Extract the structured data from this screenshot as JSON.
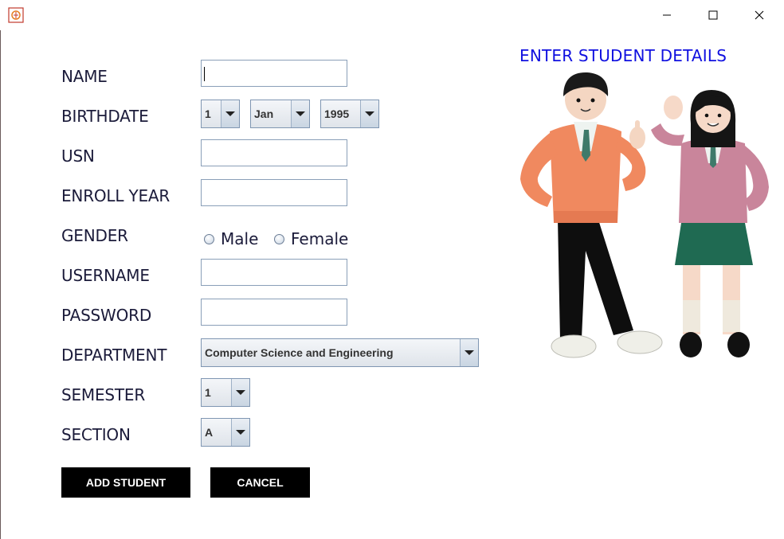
{
  "window": {
    "controls": {
      "minimize": "minimize",
      "maximize": "maximize",
      "close": "close"
    }
  },
  "heading": "ENTER STUDENT DETAILS",
  "form": {
    "name_label": "NAME",
    "name_value": "",
    "birthdate_label": "BIRTHDATE",
    "birth_day": "1",
    "birth_month": "Jan",
    "birth_year": "1995",
    "usn_label": "USN",
    "usn_value": "",
    "enroll_year_label": "ENROLL YEAR",
    "enroll_year_value": "",
    "gender_label": "GENDER",
    "gender_options": [
      "Male",
      "Female"
    ],
    "username_label": "USERNAME",
    "username_value": "",
    "password_label": "PASSWORD",
    "password_value": "",
    "department_label": "DEPARTMENT",
    "department_value": "Computer Science and Engineering",
    "semester_label": "SEMESTER",
    "semester_value": "1",
    "section_label": "SECTION",
    "section_value": "A"
  },
  "buttons": {
    "add_student": "ADD STUDENT",
    "cancel": "CANCEL"
  },
  "colors": {
    "heading": "#1010e0",
    "button_bg": "#000000",
    "button_text": "#ffffff"
  },
  "icons": [
    "app-icon",
    "minimize-icon",
    "maximize-icon",
    "close-icon",
    "chevron-down-icon"
  ]
}
